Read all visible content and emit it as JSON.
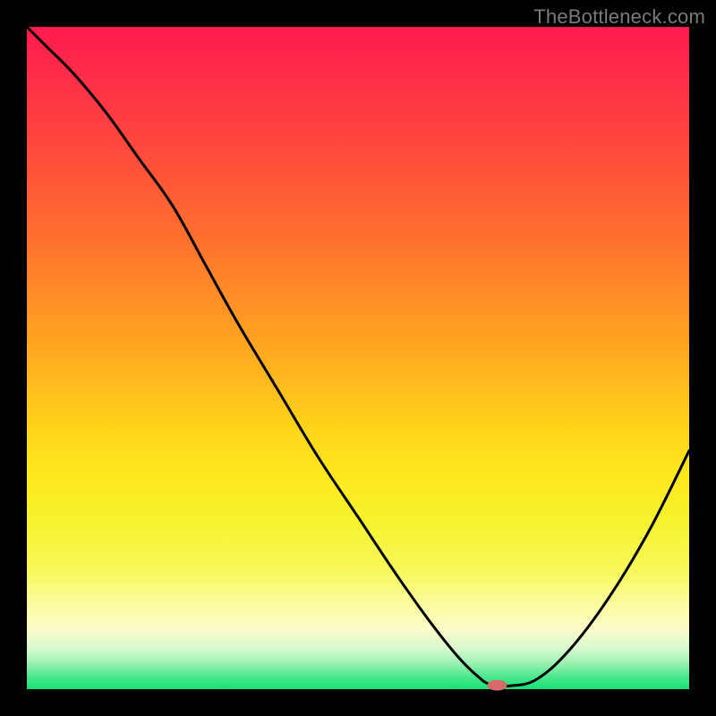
{
  "watermark": "TheBottleneck.com",
  "marker": {
    "fill": "#d46a6a",
    "rx": 11,
    "ry": 6
  },
  "curve": {
    "stroke": "#000000",
    "width": 3
  },
  "chart_data": {
    "type": "line",
    "title": "",
    "xlabel": "",
    "ylabel": "",
    "xlim": [
      0,
      100
    ],
    "ylim": [
      0,
      100
    ],
    "series": [
      {
        "name": "bottleneck-curve",
        "x": [
          0,
          3,
          7,
          12,
          17,
          22,
          27,
          32,
          38,
          44,
          50,
          56,
          61,
          65,
          68,
          70,
          73,
          77,
          82,
          88,
          94,
          100
        ],
        "values": [
          100,
          97,
          93,
          87,
          80,
          73,
          64,
          55,
          45,
          35,
          26,
          17,
          10,
          5,
          2,
          0.7,
          0.5,
          1.5,
          6,
          14,
          24,
          36
        ]
      }
    ],
    "marker_point": {
      "x": 71,
      "y": 0.6
    },
    "gradient_stops": [
      {
        "pos": 0,
        "color": "#ff1a4d"
      },
      {
        "pos": 15,
        "color": "#ff4040"
      },
      {
        "pos": 48,
        "color": "#ffa520"
      },
      {
        "pos": 74,
        "color": "#f6f22a"
      },
      {
        "pos": 91,
        "color": "#fcfcca"
      },
      {
        "pos": 100,
        "color": "#17e074"
      }
    ]
  }
}
